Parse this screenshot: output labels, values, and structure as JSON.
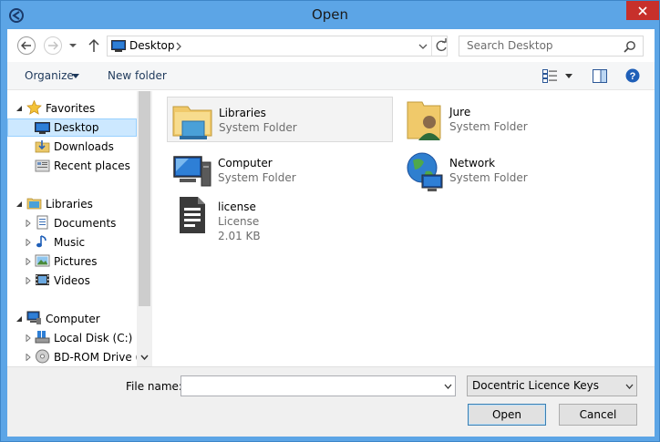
{
  "window": {
    "title": "Open"
  },
  "address_bar": {
    "location": "Desktop"
  },
  "search": {
    "placeholder": "Search Desktop"
  },
  "toolbar": {
    "organize_label": "Organize",
    "new_folder_label": "New folder"
  },
  "navigation": {
    "items": [
      {
        "label": "Favorites",
        "icon": "star-icon",
        "level": 0,
        "expanded": true
      },
      {
        "label": "Desktop",
        "icon": "desktop-icon",
        "level": 1,
        "selected": true
      },
      {
        "label": "Downloads",
        "icon": "downloads-icon",
        "level": 1
      },
      {
        "label": "Recent places",
        "icon": "recent-places-icon",
        "level": 1
      },
      {
        "label": "Libraries",
        "icon": "libraries-icon",
        "level": 0,
        "expanded": true
      },
      {
        "label": "Documents",
        "icon": "documents-icon",
        "level": 1
      },
      {
        "label": "Music",
        "icon": "music-icon",
        "level": 1
      },
      {
        "label": "Pictures",
        "icon": "pictures-icon",
        "level": 1
      },
      {
        "label": "Videos",
        "icon": "videos-icon",
        "level": 1
      },
      {
        "label": "Computer",
        "icon": "computer-icon",
        "level": 0,
        "expanded": true
      },
      {
        "label": "Local Disk (C:)",
        "icon": "local-disk-icon",
        "level": 1
      },
      {
        "label": "BD-ROM Drive (D",
        "icon": "bd-rom-icon",
        "level": 1
      }
    ]
  },
  "content": {
    "items": [
      {
        "name": "Libraries",
        "type": "System Folder",
        "icon": "libraries-folder-icon"
      },
      {
        "name": "Jure",
        "type": "System Folder",
        "icon": "user-folder-icon"
      },
      {
        "name": "Computer",
        "type": "System Folder",
        "icon": "computer-large-icon"
      },
      {
        "name": "Network",
        "type": "System Folder",
        "icon": "network-icon"
      },
      {
        "name": "license",
        "type": "License",
        "size": "2.01 KB",
        "icon": "document-icon"
      }
    ]
  },
  "footer": {
    "file_name_label": "File name:",
    "file_name_value": "",
    "file_type_value": "Docentric Licence Keys",
    "open_label": "Open",
    "cancel_label": "Cancel"
  },
  "colors": {
    "title_bar": "#5ca5e6",
    "close_button": "#c7302b",
    "selection": "#cce8ff",
    "selection_border": "#99d1ff"
  }
}
